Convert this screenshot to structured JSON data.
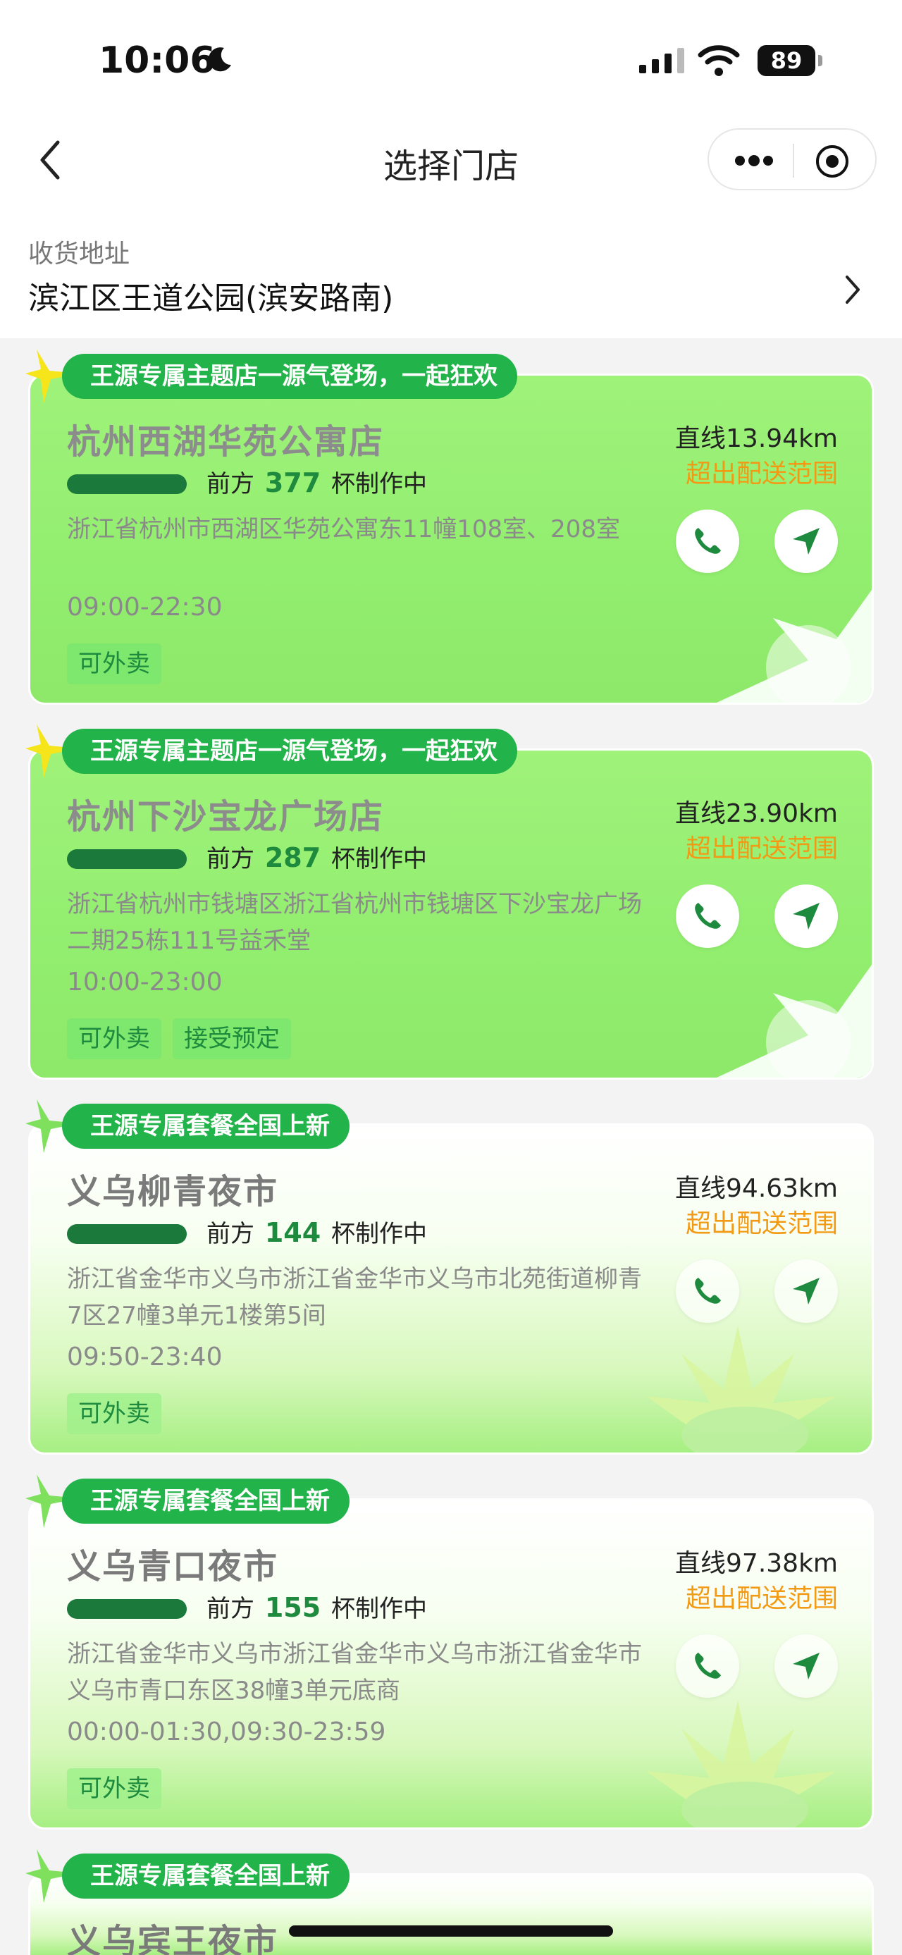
{
  "status_bar": {
    "time": "10:06",
    "battery": "89"
  },
  "nav": {
    "title": "选择门店"
  },
  "address": {
    "label": "收货地址",
    "value": "滨江区王道公园(滨安路南)"
  },
  "stores": [
    {
      "banner": "王源专属主题店一源气登场，一起狂欢",
      "name": "杭州西湖华苑公寓店",
      "queue_prefix": "前方",
      "queue_count": "377",
      "queue_suffix": "杯制作中",
      "address": "浙江省杭州市西湖区华苑公寓东11幢108室、208室",
      "hours": "09:00-22:30",
      "tags": [
        "可外卖"
      ],
      "distance": "直线13.94km",
      "range": "超出配送范围"
    },
    {
      "banner": "王源专属主题店一源气登场，一起狂欢",
      "name": "杭州下沙宝龙广场店",
      "queue_prefix": "前方",
      "queue_count": "287",
      "queue_suffix": "杯制作中",
      "address": "浙江省杭州市钱塘区浙江省杭州市钱塘区下沙宝龙广场二期25栋111号益禾堂",
      "hours": "10:00-23:00",
      "tags": [
        "可外卖",
        "接受预定"
      ],
      "distance": "直线23.90km",
      "range": "超出配送范围"
    },
    {
      "banner": "王源专属套餐全国上新",
      "name": "义乌柳青夜市",
      "queue_prefix": "前方",
      "queue_count": "144",
      "queue_suffix": "杯制作中",
      "address": "浙江省金华市义乌市浙江省金华市义乌市北苑街道柳青7区27幢3单元1楼第5间",
      "hours": "09:50-23:40",
      "tags": [
        "可外卖"
      ],
      "distance": "直线94.63km",
      "range": "超出配送范围"
    },
    {
      "banner": "王源专属套餐全国上新",
      "name": "义乌青口夜市",
      "queue_prefix": "前方",
      "queue_count": "155",
      "queue_suffix": "杯制作中",
      "address": "浙江省金华市义乌市浙江省金华市义乌市浙江省金华市义乌市青口东区38幢3单元底商",
      "hours": "00:00-01:30,09:30-23:59",
      "tags": [
        "可外卖"
      ],
      "distance": "直线97.38km",
      "range": "超出配送范围"
    },
    {
      "banner": "王源专属套餐全国上新",
      "name": "义乌宾王夜市"
    }
  ]
}
